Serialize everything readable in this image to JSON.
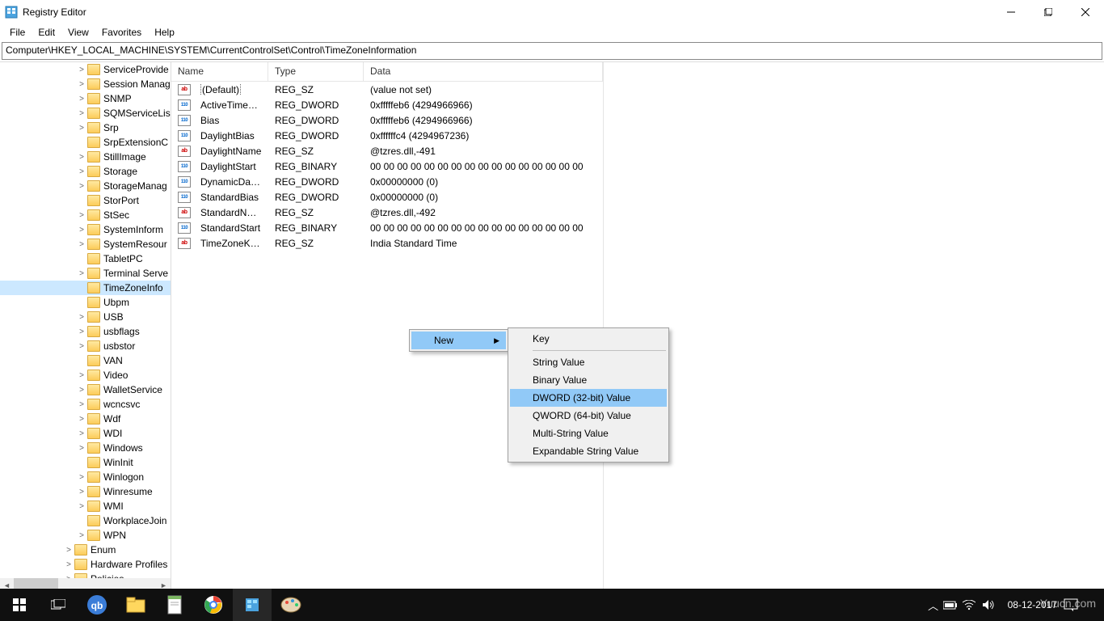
{
  "window": {
    "title": "Registry Editor",
    "menu": [
      "File",
      "Edit",
      "View",
      "Favorites",
      "Help"
    ],
    "address": "Computer\\HKEY_LOCAL_MACHINE\\SYSTEM\\CurrentControlSet\\Control\\TimeZoneInformation"
  },
  "tree": [
    {
      "label": "ServiceProvide",
      "exp": ">",
      "depth": 2
    },
    {
      "label": "Session Manag",
      "exp": ">",
      "depth": 2
    },
    {
      "label": "SNMP",
      "exp": ">",
      "depth": 2
    },
    {
      "label": "SQMServiceLis",
      "exp": ">",
      "depth": 2
    },
    {
      "label": "Srp",
      "exp": ">",
      "depth": 2
    },
    {
      "label": "SrpExtensionC",
      "exp": "",
      "depth": 2
    },
    {
      "label": "StillImage",
      "exp": ">",
      "depth": 2
    },
    {
      "label": "Storage",
      "exp": ">",
      "depth": 2
    },
    {
      "label": "StorageManag",
      "exp": ">",
      "depth": 2
    },
    {
      "label": "StorPort",
      "exp": "",
      "depth": 2
    },
    {
      "label": "StSec",
      "exp": ">",
      "depth": 2
    },
    {
      "label": "SystemInform",
      "exp": ">",
      "depth": 2
    },
    {
      "label": "SystemResour",
      "exp": ">",
      "depth": 2
    },
    {
      "label": "TabletPC",
      "exp": "",
      "depth": 2
    },
    {
      "label": "Terminal Serve",
      "exp": ">",
      "depth": 2
    },
    {
      "label": "TimeZoneInfo",
      "exp": "",
      "depth": 2,
      "selected": true
    },
    {
      "label": "Ubpm",
      "exp": "",
      "depth": 2
    },
    {
      "label": "USB",
      "exp": ">",
      "depth": 2
    },
    {
      "label": "usbflags",
      "exp": ">",
      "depth": 2
    },
    {
      "label": "usbstor",
      "exp": ">",
      "depth": 2
    },
    {
      "label": "VAN",
      "exp": "",
      "depth": 2
    },
    {
      "label": "Video",
      "exp": ">",
      "depth": 2
    },
    {
      "label": "WalletService",
      "exp": ">",
      "depth": 2
    },
    {
      "label": "wcncsvc",
      "exp": ">",
      "depth": 2
    },
    {
      "label": "Wdf",
      "exp": ">",
      "depth": 2
    },
    {
      "label": "WDI",
      "exp": ">",
      "depth": 2
    },
    {
      "label": "Windows",
      "exp": ">",
      "depth": 2
    },
    {
      "label": "WinInit",
      "exp": "",
      "depth": 2
    },
    {
      "label": "Winlogon",
      "exp": ">",
      "depth": 2
    },
    {
      "label": "Winresume",
      "exp": ">",
      "depth": 2
    },
    {
      "label": "WMI",
      "exp": ">",
      "depth": 2
    },
    {
      "label": "WorkplaceJoin",
      "exp": "",
      "depth": 2
    },
    {
      "label": "WPN",
      "exp": ">",
      "depth": 2
    },
    {
      "label": "Enum",
      "exp": ">",
      "depth": 1
    },
    {
      "label": "Hardware Profiles",
      "exp": ">",
      "depth": 1
    },
    {
      "label": "Policies",
      "exp": ">",
      "depth": 1
    }
  ],
  "columns": {
    "name": "Name",
    "type": "Type",
    "data": "Data"
  },
  "values": [
    {
      "icon": "sz",
      "name": "(Default)",
      "type": "REG_SZ",
      "data": "(value not set)",
      "boxed": true
    },
    {
      "icon": "dw",
      "name": "ActiveTimeBias",
      "type": "REG_DWORD",
      "data": "0xfffffeb6 (4294966966)"
    },
    {
      "icon": "dw",
      "name": "Bias",
      "type": "REG_DWORD",
      "data": "0xfffffeb6 (4294966966)"
    },
    {
      "icon": "dw",
      "name": "DaylightBias",
      "type": "REG_DWORD",
      "data": "0xffffffc4 (4294967236)"
    },
    {
      "icon": "sz",
      "name": "DaylightName",
      "type": "REG_SZ",
      "data": "@tzres.dll,-491"
    },
    {
      "icon": "dw",
      "name": "DaylightStart",
      "type": "REG_BINARY",
      "data": "00 00 00 00 00 00 00 00 00 00 00 00 00 00 00 00"
    },
    {
      "icon": "dw",
      "name": "DynamicDayligh...",
      "type": "REG_DWORD",
      "data": "0x00000000 (0)"
    },
    {
      "icon": "dw",
      "name": "StandardBias",
      "type": "REG_DWORD",
      "data": "0x00000000 (0)"
    },
    {
      "icon": "sz",
      "name": "StandardName",
      "type": "REG_SZ",
      "data": "@tzres.dll,-492"
    },
    {
      "icon": "dw",
      "name": "StandardStart",
      "type": "REG_BINARY",
      "data": "00 00 00 00 00 00 00 00 00 00 00 00 00 00 00 00"
    },
    {
      "icon": "sz",
      "name": "TimeZoneKeyN...",
      "type": "REG_SZ",
      "data": "India Standard Time"
    }
  ],
  "context_menu": {
    "main": [
      {
        "label": "New",
        "sub": true,
        "highlight": true
      }
    ],
    "sub": [
      {
        "label": "Key"
      },
      {
        "sep": true
      },
      {
        "label": "String Value"
      },
      {
        "label": "Binary Value"
      },
      {
        "label": "DWORD (32-bit) Value",
        "highlight": true
      },
      {
        "label": "QWORD (64-bit) Value"
      },
      {
        "label": "Multi-String Value"
      },
      {
        "label": "Expandable String Value"
      }
    ]
  },
  "taskbar": {
    "time": "08-12-2017"
  },
  "watermark": "Yuucn.com"
}
